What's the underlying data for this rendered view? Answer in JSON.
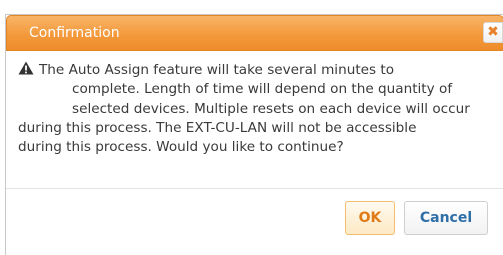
{
  "dialog": {
    "title": "Confirmation",
    "close_label": "✖",
    "icon": "warning-icon",
    "message_lines": [
      "The Auto Assign feature will take several minutes to",
      "complete. Length of time will depend on the quantity of",
      "selected devices. Multiple resets on each device will occur",
      "during this process. The EXT-CU-LAN will not be accessible",
      "during this process. Would you like to continue?"
    ],
    "ok_label": "OK",
    "cancel_label": "Cancel"
  },
  "colors": {
    "titlebar": "#f39a3c",
    "ok_text": "#e07a16",
    "cancel_text": "#2f6fa8"
  }
}
